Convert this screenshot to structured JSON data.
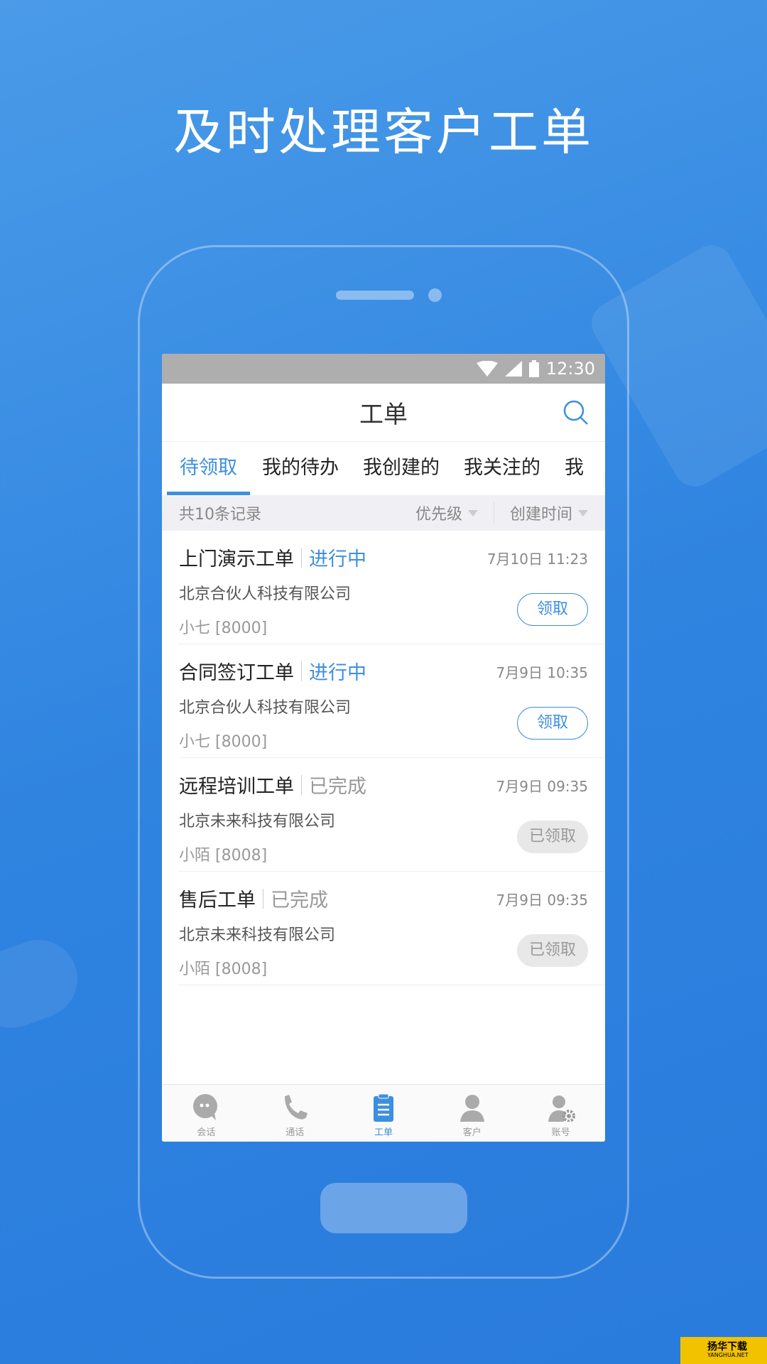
{
  "headline": "及时处理客户工单",
  "status_bar": {
    "time": "12:30"
  },
  "header": {
    "title": "工单",
    "search_icon": "search-icon"
  },
  "tabs": [
    {
      "label": "待领取",
      "active": true
    },
    {
      "label": "我的待办"
    },
    {
      "label": "我创建的"
    },
    {
      "label": "我关注的"
    },
    {
      "label": "我"
    }
  ],
  "filter": {
    "count": "共10条记录",
    "sort1": "优先级",
    "sort2": "创建时间"
  },
  "tickets": [
    {
      "title": "上门演示工单",
      "status": "进行中",
      "company": "北京合伙人科技有限公司",
      "agent": "小七 [8000]",
      "time": "7月10日 11:23",
      "action": "领取",
      "claimed": false
    },
    {
      "title": "合同签订工单",
      "status": "进行中",
      "company": "北京合伙人科技有限公司",
      "agent": "小七 [8000]",
      "time": "7月9日 10:35",
      "action": "领取",
      "claimed": false
    },
    {
      "title": "远程培训工单",
      "status": "已完成",
      "company": "北京未来科技有限公司",
      "agent": "小陌 [8008]",
      "time": "7月9日 09:35",
      "action": "已领取",
      "claimed": true
    },
    {
      "title": "售后工单",
      "status": "已完成",
      "company": "北京未来科技有限公司",
      "agent": "小陌 [8008]",
      "time": "7月9日 09:35",
      "action": "已领取",
      "claimed": true
    }
  ],
  "nav": [
    {
      "label": "会话",
      "icon": "chat-icon"
    },
    {
      "label": "通话",
      "icon": "phone-icon"
    },
    {
      "label": "工单",
      "icon": "clipboard-icon",
      "active": true
    },
    {
      "label": "客户",
      "icon": "user-icon"
    },
    {
      "label": "账号",
      "icon": "user-gear-icon"
    }
  ],
  "watermark": {
    "text": "扬华下载",
    "sub": "YANGHUA.NET"
  },
  "colors": {
    "accent": "#3d8fe0",
    "background": "#2f84e0"
  }
}
